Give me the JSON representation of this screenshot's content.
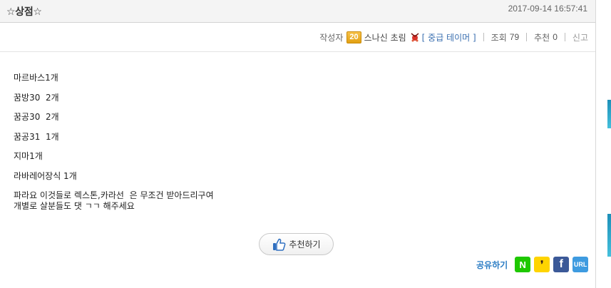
{
  "post": {
    "title": "☆상점☆",
    "date": "2017-09-14 16:57:41",
    "author_label": "작성자",
    "author_level": "20",
    "author_name": "스나신 초림",
    "guild_name": "[ 중급 테이머 ]",
    "views_label": "조회",
    "views": "79",
    "recommend_label": "추천",
    "recommend": "0",
    "report_label": "신고",
    "body_lines": [
      "마르바스1개",
      "꿈방30  2개",
      "꿈공30  2개",
      "꿈공31  1개",
      "지마1개",
      "라바레어장식 1개",
      "파라요 이것들로 렉스톤,카라선  은 무조건 받아드리구여",
      "개별로 살분들도 댓 ㄱㄱ 해주세요"
    ]
  },
  "recommend_button": {
    "label": "추천하기",
    "icon": "thumbs-up-icon"
  },
  "share": {
    "label": "공유하기",
    "buttons": [
      {
        "name": "naver",
        "glyph": "N",
        "color": "#1ec800"
      },
      {
        "name": "kakaostory",
        "glyph": "❜",
        "color": "#ffd400"
      },
      {
        "name": "facebook",
        "glyph": "f",
        "color": "#3b5998"
      },
      {
        "name": "url",
        "glyph": "URL",
        "color": "#3e9be0"
      }
    ]
  }
}
